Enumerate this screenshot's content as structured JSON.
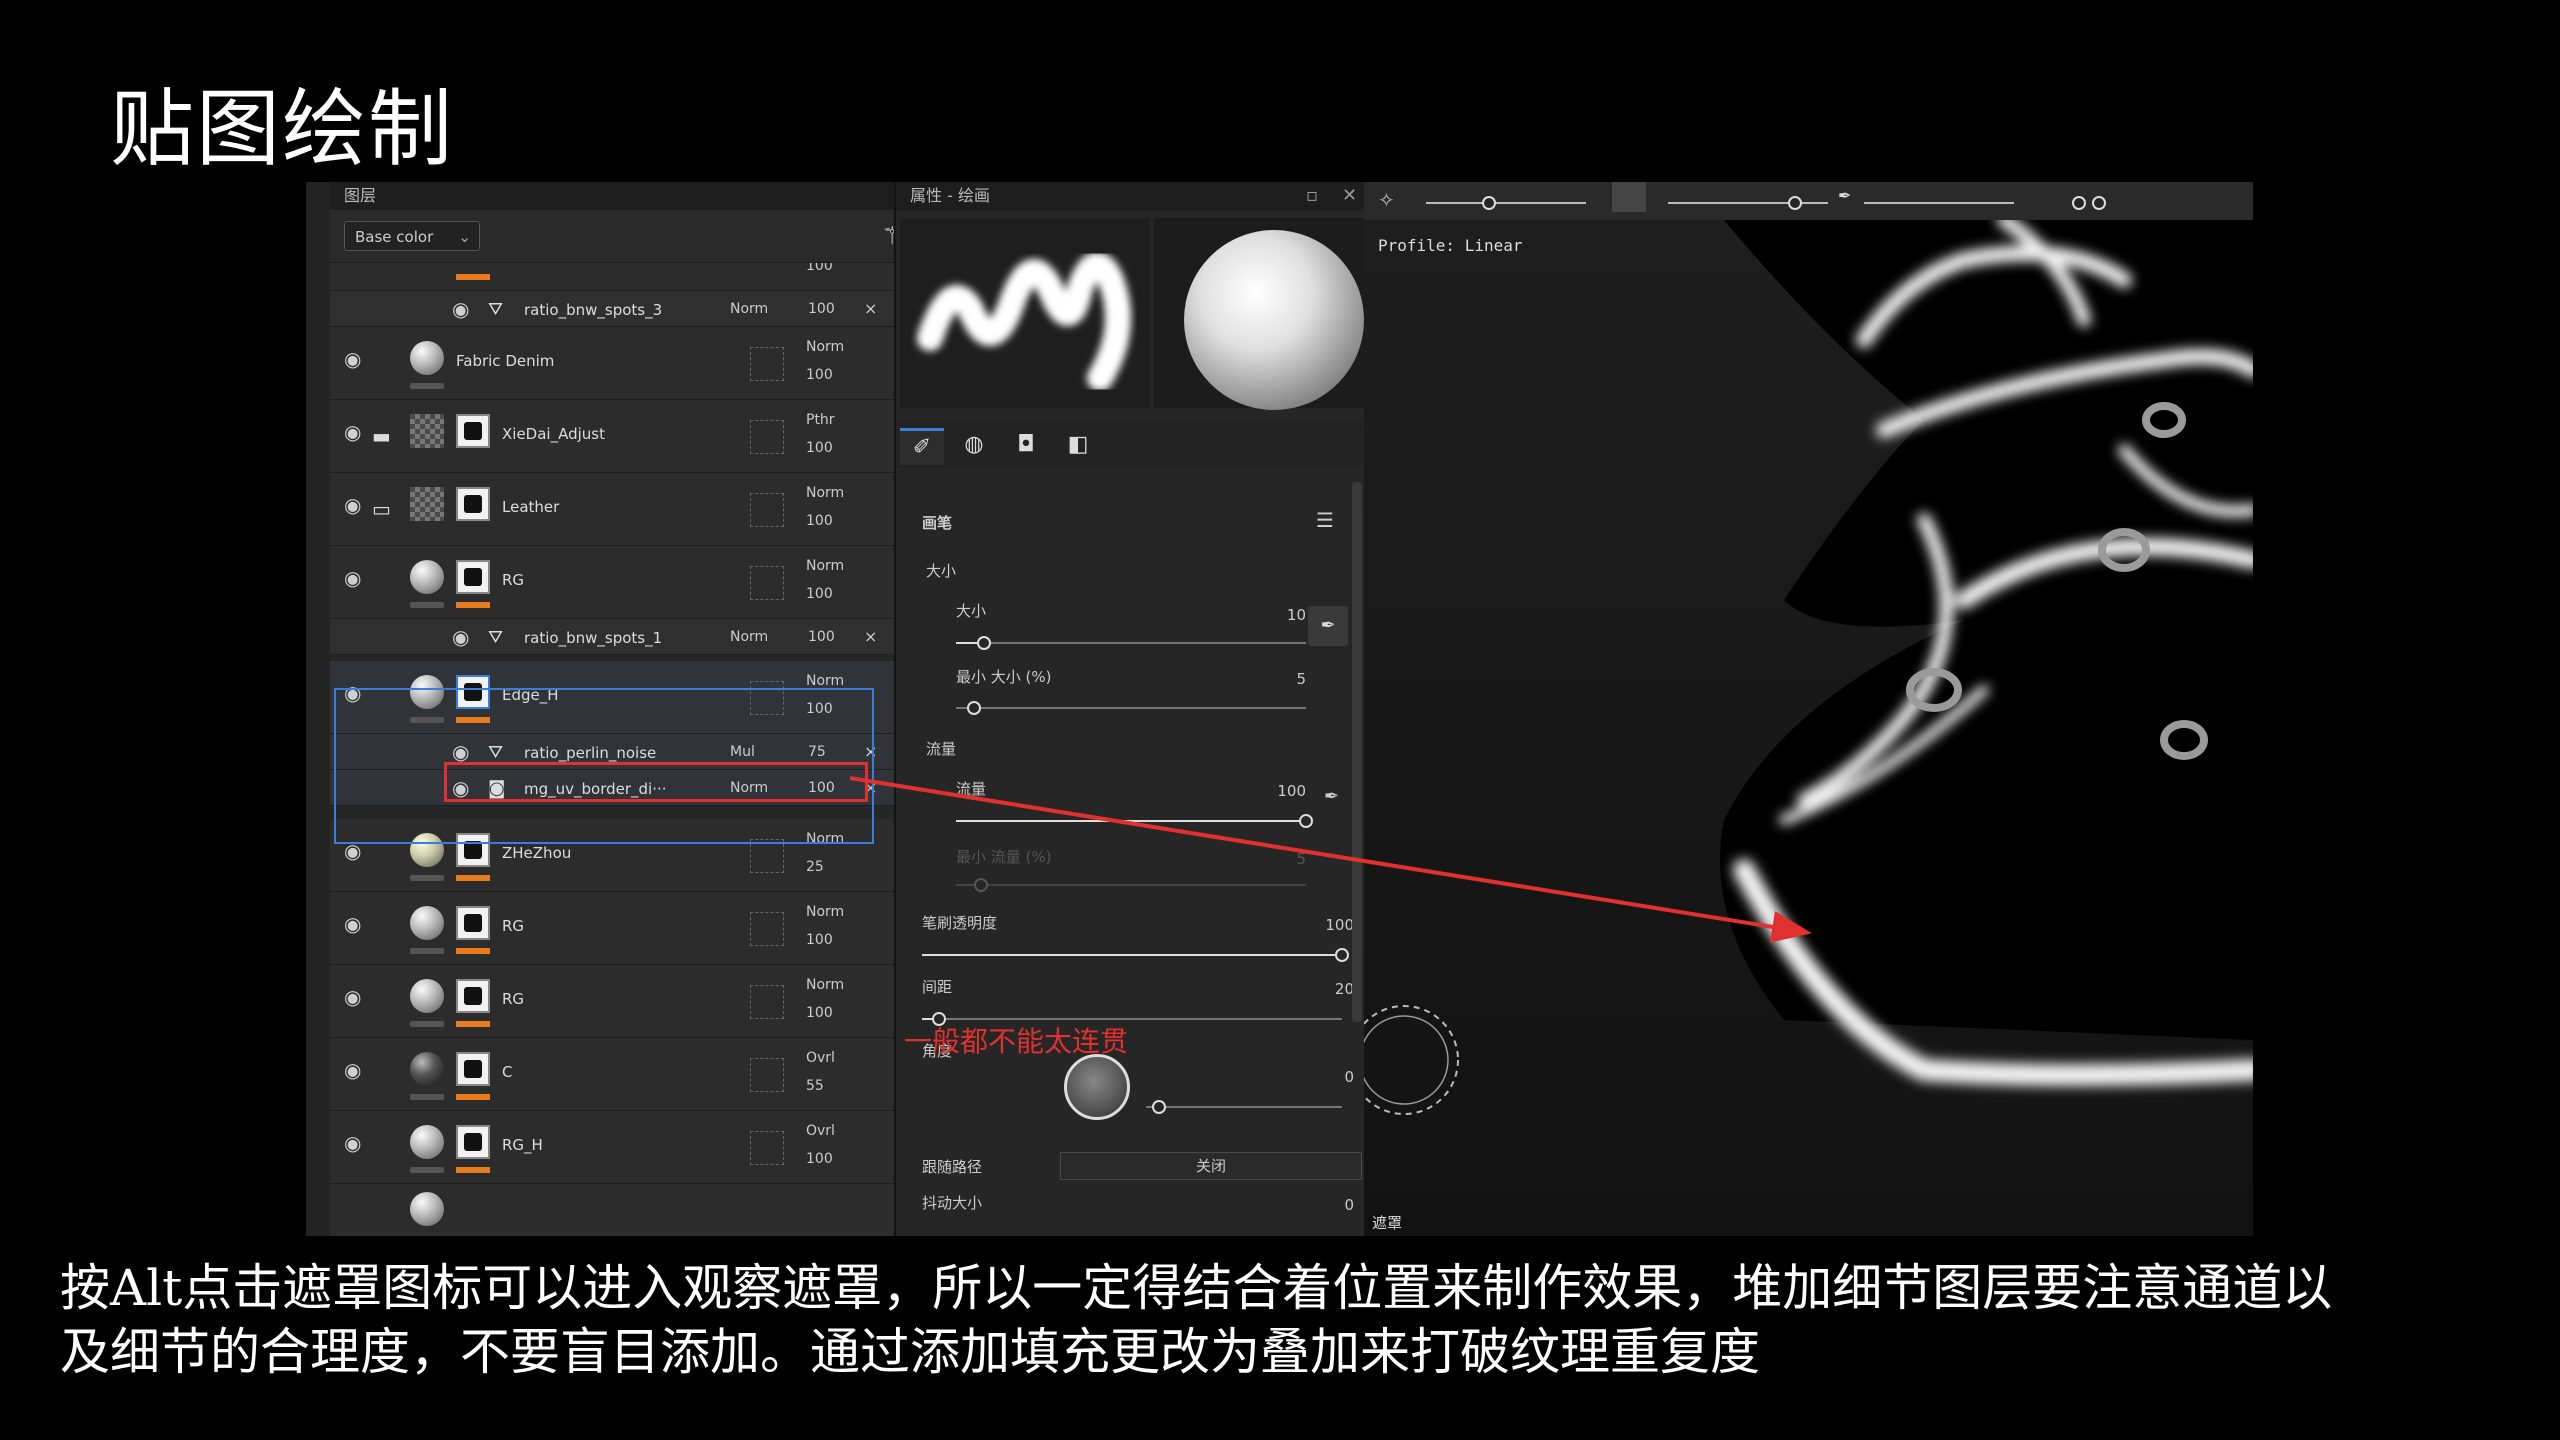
{
  "slide": {
    "title": "贴图绘制",
    "caption_line1": "按Alt点击遮罩图标可以进入观察遮罩，所以一定得结合着位置来制作效果，堆加细节图层要注意通道以",
    "caption_line2": "及细节的合理度，不要盲目添加。通过添加填充更改为叠加来打破纹理重复度",
    "annotation": "一般都不能太连贯",
    "annotation_color": "#e03030",
    "highlight_color": "#3b7ddd",
    "mask_bar_color": "#e87b1e"
  },
  "layer_panel": {
    "title": "图层",
    "channel": "Base color",
    "tools": [
      "magic-wand-icon",
      "mask-icon",
      "paint-brush-icon",
      "fill-bucket-icon",
      "smart-material-icon",
      "folder-icon",
      "trash-icon"
    ],
    "top_opacity": "100",
    "layers": [
      {
        "kind": "sub",
        "name": "ratio_bnw_spots_3",
        "blend": "Norm",
        "opacity": "100"
      },
      {
        "kind": "layer",
        "name": "Fabric Denim",
        "blend": "Norm",
        "opacity": "100",
        "thumb": "sphere",
        "mask": false
      },
      {
        "kind": "folder",
        "name": "XieDai_Adjust",
        "blend": "Pthr",
        "opacity": "100"
      },
      {
        "kind": "folder-open",
        "name": "Leather",
        "blend": "Norm",
        "opacity": "100"
      },
      {
        "kind": "layer",
        "name": "RG",
        "blend": "Norm",
        "opacity": "100",
        "thumb": "sphere",
        "mask": true
      },
      {
        "kind": "sub",
        "name": "ratio_bnw_spots_1",
        "blend": "Norm",
        "opacity": "100"
      },
      {
        "kind": "layer",
        "name": "Edge_H",
        "blend": "Norm",
        "opacity": "100",
        "thumb": "sphere",
        "mask": true,
        "selected": true
      },
      {
        "kind": "sub",
        "name": "ratio_perlin_noise",
        "blend": "Mul",
        "opacity": "75",
        "highlight": true
      },
      {
        "kind": "sub",
        "name": "mg_uv_border_di···",
        "blend": "Norm",
        "opacity": "100"
      },
      {
        "kind": "layer",
        "name": "ZHeZhou",
        "blend": "Norm",
        "opacity": "25",
        "thumb": "cream",
        "mask": true
      },
      {
        "kind": "layer",
        "name": "RG",
        "blend": "Norm",
        "opacity": "100",
        "thumb": "sphere",
        "mask": true
      },
      {
        "kind": "layer",
        "name": "RG",
        "blend": "Norm",
        "opacity": "100",
        "thumb": "sphere",
        "mask": true
      },
      {
        "kind": "layer",
        "name": "C",
        "blend": "Ovrl",
        "opacity": "55",
        "thumb": "dark",
        "mask": true
      },
      {
        "kind": "layer",
        "name": "RG_H",
        "blend": "Ovrl",
        "opacity": "100",
        "thumb": "sphere",
        "mask": true
      }
    ]
  },
  "properties_panel": {
    "title": "属性 - 绘画",
    "section": "画笔",
    "size_group": "大小",
    "size_label": "大小",
    "size_value": "10",
    "size_fraction": 0.08,
    "min_size_label": "最小 大小 (%)",
    "min_size_value": "5",
    "min_size_fraction": 0.05,
    "flow_group": "流量",
    "flow_label": "流量",
    "flow_value": "100",
    "flow_fraction": 1.0,
    "min_flow_label": "最小 流量 (%)",
    "min_flow_value": "5",
    "opacity_label": "笔刷透明度",
    "opacity_value": "100",
    "opacity_fraction": 1.0,
    "spacing_label": "间距",
    "spacing_value": "20",
    "spacing_fraction": 0.04,
    "angle_label": "角度",
    "angle_value": "0",
    "follow_path_label": "跟随路径",
    "follow_path_value": "关闭",
    "jitter_label": "抖动大小",
    "jitter_value": "0"
  },
  "viewport": {
    "profile": "Profile: Linear",
    "badge": "遮罩"
  }
}
